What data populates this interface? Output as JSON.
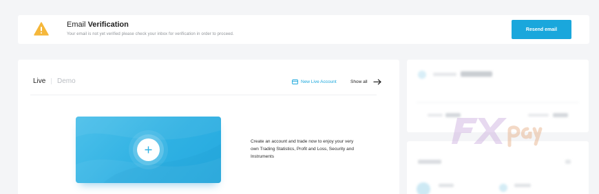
{
  "banner": {
    "title_prefix": "Email ",
    "title_bold": "Verification",
    "subtitle": "Your email is not yet verified please check your inbox for verification in order to proceed.",
    "resend_label": "Resend email",
    "warning_icon": "warning-triangle-icon",
    "warning_color": "#f5b73b"
  },
  "accounts": {
    "tabs": [
      {
        "label": "Live",
        "active": true
      },
      {
        "label": "Demo",
        "active": false
      }
    ],
    "new_account_label": "New Live Account",
    "show_all_label": "Show all",
    "promo_text": "Create an account and trade now to enjoy your very own Trading Statistics, Profit and Loss, Security and Instruments",
    "accent_color": "#1aa7dc"
  },
  "watermark": {
    "brand": "FXpay"
  }
}
